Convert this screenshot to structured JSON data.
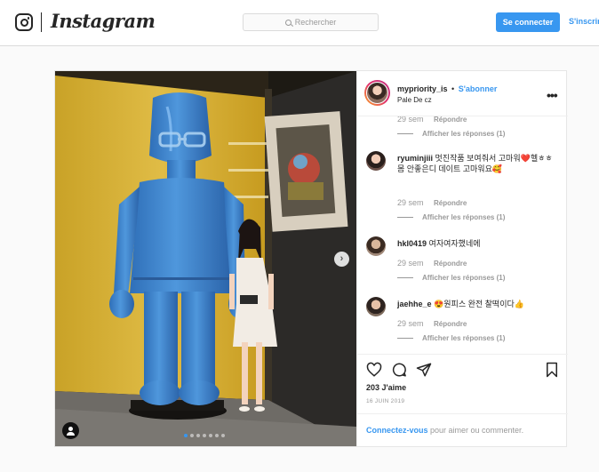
{
  "brand": {
    "wordmark": "Instagram"
  },
  "topnav": {
    "search_placeholder": "Rechercher",
    "login_label": "Se connecter",
    "signup_label": "S'inscrire"
  },
  "post": {
    "author": {
      "username": "mypriority_is",
      "separator": "•",
      "follow_label": "S'abonner",
      "location": "Pale De cz"
    },
    "carousel": {
      "slide_count": 7,
      "active_index": 0
    },
    "comments": [
      {
        "username": "",
        "text": "",
        "time": "29 sem",
        "reply_label": "Répondre",
        "view_replies": "Afficher les réponses (1)"
      },
      {
        "username": "ryuminjiii",
        "text": "멋진작품 보여줘서 고마워❤️헬ㅎㅎ 몸 안좋은디 데이트 고마워요🥰",
        "time": "29 sem",
        "reply_label": "Répondre",
        "view_replies": "Afficher les réponses (1)"
      },
      {
        "username": "hkl0419",
        "text": "여자여자했네에",
        "time": "29 sem",
        "reply_label": "Répondre",
        "view_replies": "Afficher les réponses (1)"
      },
      {
        "username": "jaehhe_e",
        "text": "😍원피스 완전 찰떡이다👍",
        "time": "29 sem",
        "reply_label": "Répondre",
        "view_replies": "Afficher les réponses (1)"
      }
    ],
    "likes": "203 J'aime",
    "date": "16 JUIN 2019",
    "login_prompt": {
      "link": "Connectez-vous",
      "rest": " pour aimer ou commenter."
    }
  },
  "colors": {
    "accent": "#3897f0",
    "text": "#262626",
    "muted": "#999999",
    "border": "#dbdbdb"
  },
  "icons": [
    "instagram-glyph-icon",
    "search-icon",
    "more-options-icon",
    "next-arrow-icon",
    "user-tag-icon",
    "heart-icon",
    "comment-icon",
    "share-icon",
    "bookmark-icon"
  ]
}
